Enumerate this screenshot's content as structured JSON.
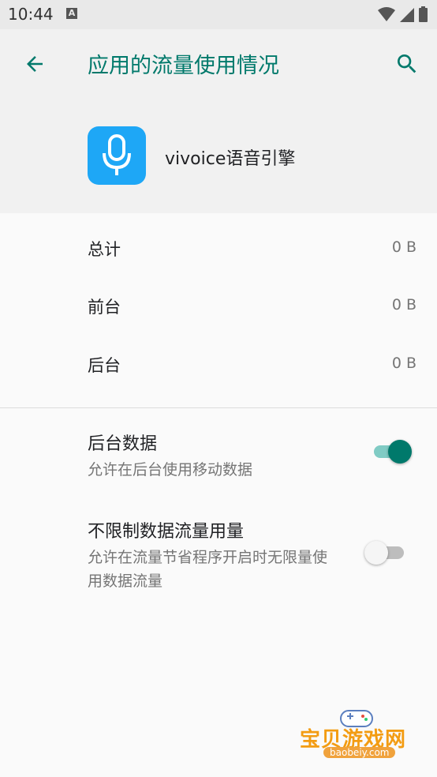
{
  "status_bar": {
    "time": "10:44",
    "notification_letter": "A"
  },
  "toolbar": {
    "title": "应用的流量使用情况"
  },
  "app": {
    "name": "vivoice语音引擎",
    "icon": "microphone-icon"
  },
  "usage": [
    {
      "label": "总计",
      "value": "0 B"
    },
    {
      "label": "前台",
      "value": "0 B"
    },
    {
      "label": "后台",
      "value": "0 B"
    }
  ],
  "prefs": {
    "background_data": {
      "title": "后台数据",
      "summary": "允许在后台使用移动数据",
      "enabled": true
    },
    "unrestricted": {
      "title": "不限制数据流量用量",
      "summary": "允许在流量节省程序开启时无限量使用数据流量",
      "enabled": false
    }
  },
  "watermark": {
    "text": "宝贝游戏网",
    "url": "baobeiy.com"
  },
  "colors": {
    "accent": "#00796b",
    "app_icon_bg": "#1ea7f6",
    "switch_on_track": "#80cbc4",
    "switch_off_thumb": "#f5f5f5"
  }
}
